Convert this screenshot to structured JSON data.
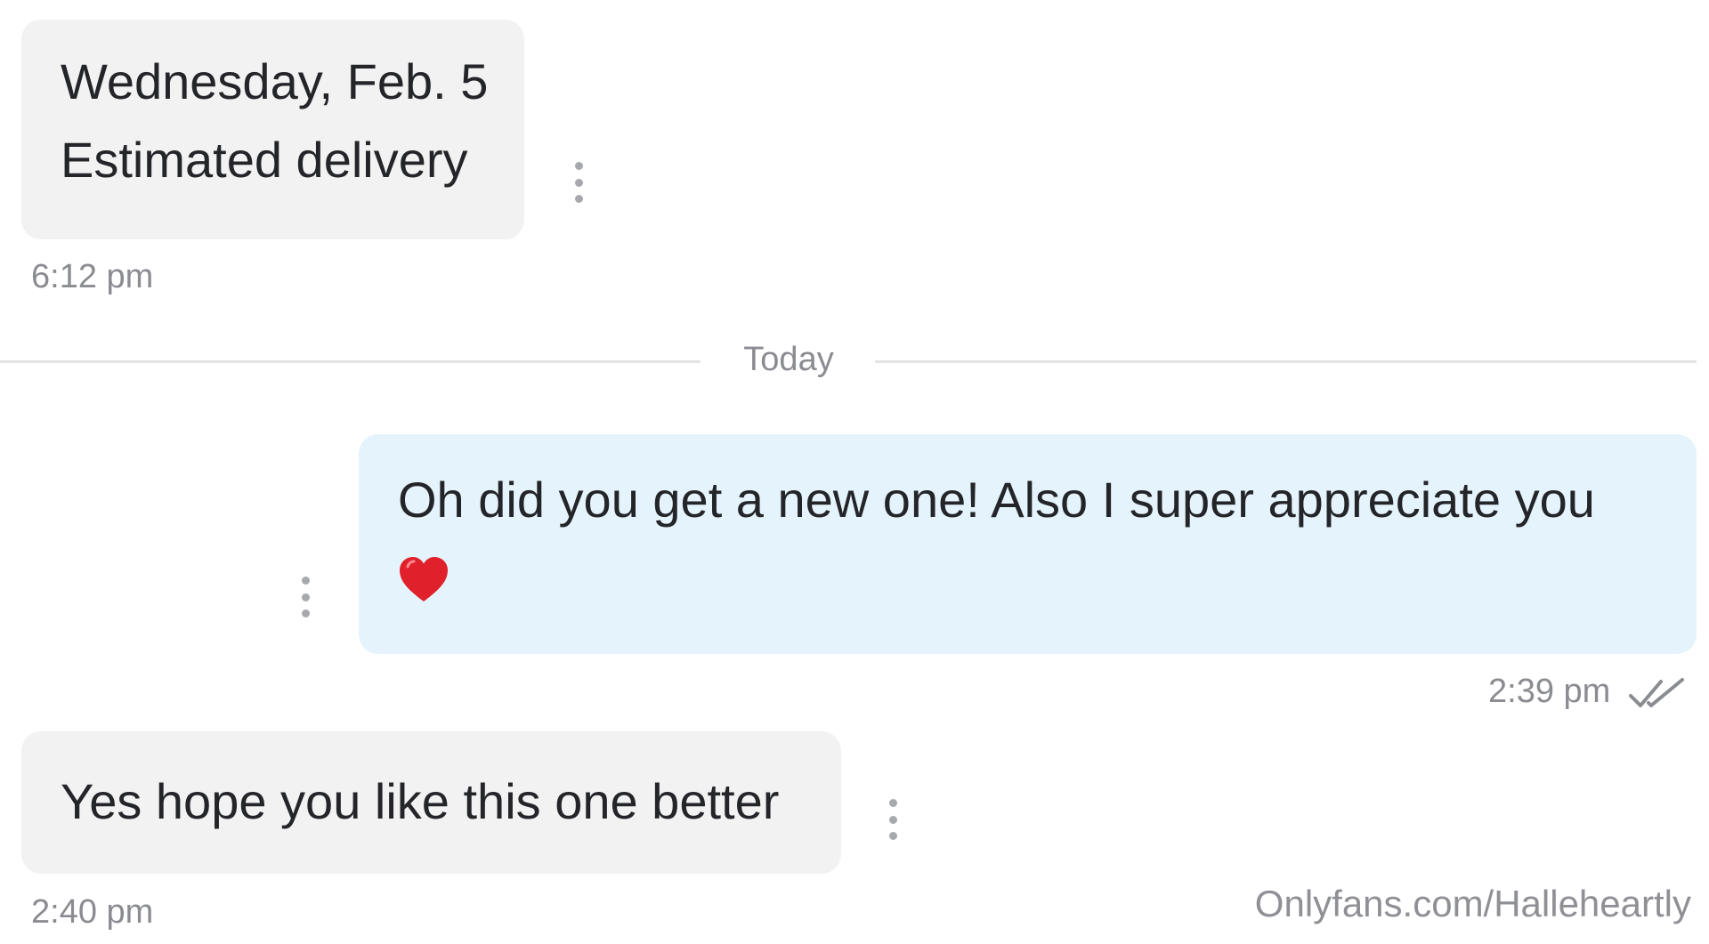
{
  "conversation": {
    "messages": [
      {
        "direction": "incoming",
        "lines": [
          "Wednesday, Feb. 5",
          "Estimated delivery"
        ],
        "time": "6:12 pm"
      },
      {
        "direction": "outgoing",
        "lines": [
          "Oh did you get a new one! Also I super appreciate you"
        ],
        "emoji": "❤️",
        "time": "2:39 pm",
        "status_icon": "double-check-icon"
      },
      {
        "direction": "incoming",
        "lines": [
          "Yes hope you like this one better"
        ],
        "time": "2:40 pm"
      }
    ],
    "date_divider": "Today"
  },
  "watermark": "Onlyfans.com/Halleheartly",
  "colors": {
    "incoming_bubble": "#f2f2f2",
    "outgoing_bubble": "#e5f4fc",
    "message_text": "#242529",
    "meta_text": "#8a8c91",
    "divider": "#e3e3e3",
    "heart": "#e0212b"
  },
  "icons": {
    "message_menu": "vertical-dots-icon",
    "read_status": "double-check-icon",
    "emoji": "red-heart-icon"
  }
}
